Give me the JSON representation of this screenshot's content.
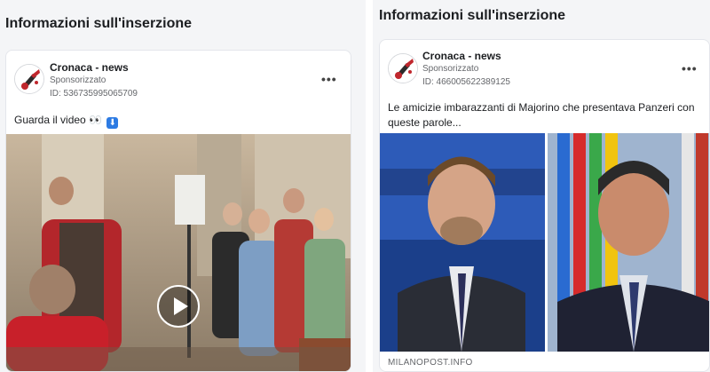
{
  "left_panel": {
    "section_title": "Informazioni sull'inserzione",
    "ad": {
      "page_name": "Cronaca - news",
      "sponsored_label": "Sponsorizzato",
      "ad_id": "ID: 536735995065709",
      "body_text": "Guarda il video 👀",
      "body_emoji_icon": "arrow-down-icon",
      "media_type": "video",
      "more_icon": "more-options-icon"
    }
  },
  "right_panel": {
    "section_title": "Informazioni sull'inserzione",
    "ad": {
      "page_name": "Cronaca - news",
      "sponsored_label": "Sponsorizzato",
      "ad_id": "ID: 466005622389125",
      "body_text": "Le amicizie imbarazzanti di Majorino che presentava Panzeri con queste parole...",
      "media_type": "image",
      "link_domain": "MILANOPOST.INFO",
      "more_icon": "more-options-icon"
    }
  },
  "colors": {
    "background": "#f4f5f7",
    "card": "#ffffff",
    "text_primary": "#1c1e21",
    "text_secondary": "#65676b"
  }
}
